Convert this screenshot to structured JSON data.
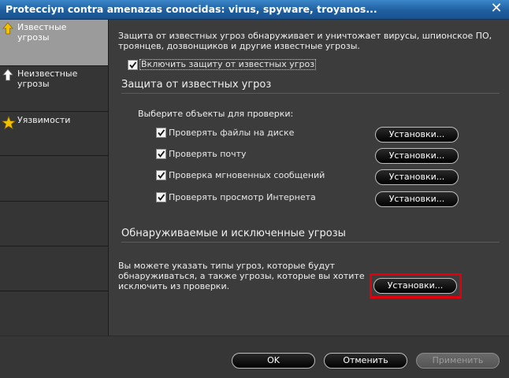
{
  "window": {
    "title": "Protecciyn contra amenazas conocidas: virus, spyware, troyanos...",
    "close_glyph": "✕"
  },
  "sidebar": {
    "items": [
      {
        "label": "Известные угрозы",
        "icon": "arrow-up-icon",
        "selected": true
      },
      {
        "label": "Неизвестные угрозы",
        "icon": "arrow-up-icon",
        "selected": false
      },
      {
        "label": "Уязвимости",
        "icon": "star-icon",
        "selected": false
      }
    ]
  },
  "main": {
    "description": "Защита от известных угроз обнаруживает и уничтожает вирусы, шпионское ПО, троянцев, дозвонщиков и другие известные угрозы.",
    "enable_label": "Включить защиту от известных угроз",
    "enable_checked": true,
    "section1_title": "Защита от известных угроз",
    "choose_label": "Выберите объекты для проверки:",
    "options": [
      {
        "label": "Проверять файлы на диске",
        "checked": true,
        "button": "Установки..."
      },
      {
        "label": "Проверять почту",
        "checked": true,
        "button": "Установки..."
      },
      {
        "label": "Проверка мгновенных сообщений",
        "checked": true,
        "button": "Установки..."
      },
      {
        "label": "Проверять просмотр Интернета",
        "checked": true,
        "button": "Установки..."
      }
    ],
    "section2_title": "Обнаруживаемые и исключенные угрозы",
    "threats_text": "Вы можете указать типы угроз, которые будут обнаруживаться, а также угрозы, которые вы хотите исключить из проверки.",
    "threats_button": "Установки..."
  },
  "footer": {
    "ok": "OK",
    "cancel": "Отменить",
    "apply": "Применить"
  },
  "colors": {
    "titlebar": "#2a73b8",
    "highlight": "#e0000b",
    "selected_item": "#9b9b9b",
    "icon_yellow": "#f2c200"
  }
}
